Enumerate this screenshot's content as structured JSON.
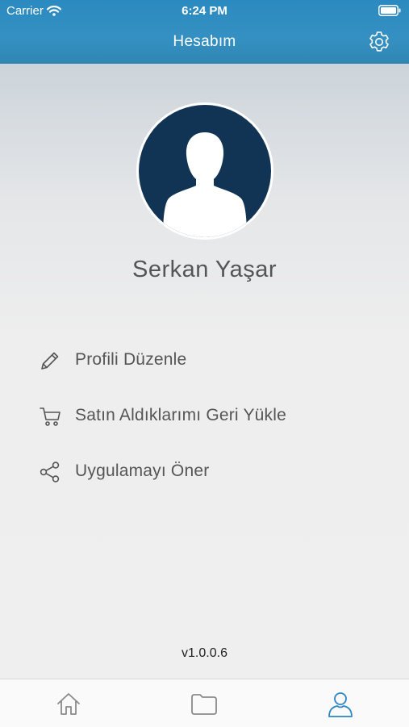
{
  "status_bar": {
    "carrier": "Carrier",
    "time": "6:24 PM",
    "wifi_icon": "wifi-icon",
    "battery_icon": "battery-icon"
  },
  "nav": {
    "title": "Hesabım",
    "settings_icon": "gear-icon"
  },
  "profile": {
    "avatar_icon": "user-silhouette-icon",
    "name": "Serkan Yaşar"
  },
  "menu": [
    {
      "icon": "pencil-icon",
      "label": "Profili Düzenle"
    },
    {
      "icon": "cart-icon",
      "label": "Satın Aldıklarımı Geri Yükle"
    },
    {
      "icon": "share-icon",
      "label": "Uygulamayı Öner"
    }
  ],
  "version": "v1.0.0.6",
  "tabbar": {
    "tabs": [
      {
        "icon": "home-icon",
        "active": false
      },
      {
        "icon": "folder-icon",
        "active": false
      },
      {
        "icon": "user-icon",
        "active": true
      }
    ]
  },
  "colors": {
    "header": "#2b8ac0",
    "avatar_bg": "#123454",
    "active_tab": "#2a86c4",
    "inactive_tab": "#8a8a8a"
  }
}
